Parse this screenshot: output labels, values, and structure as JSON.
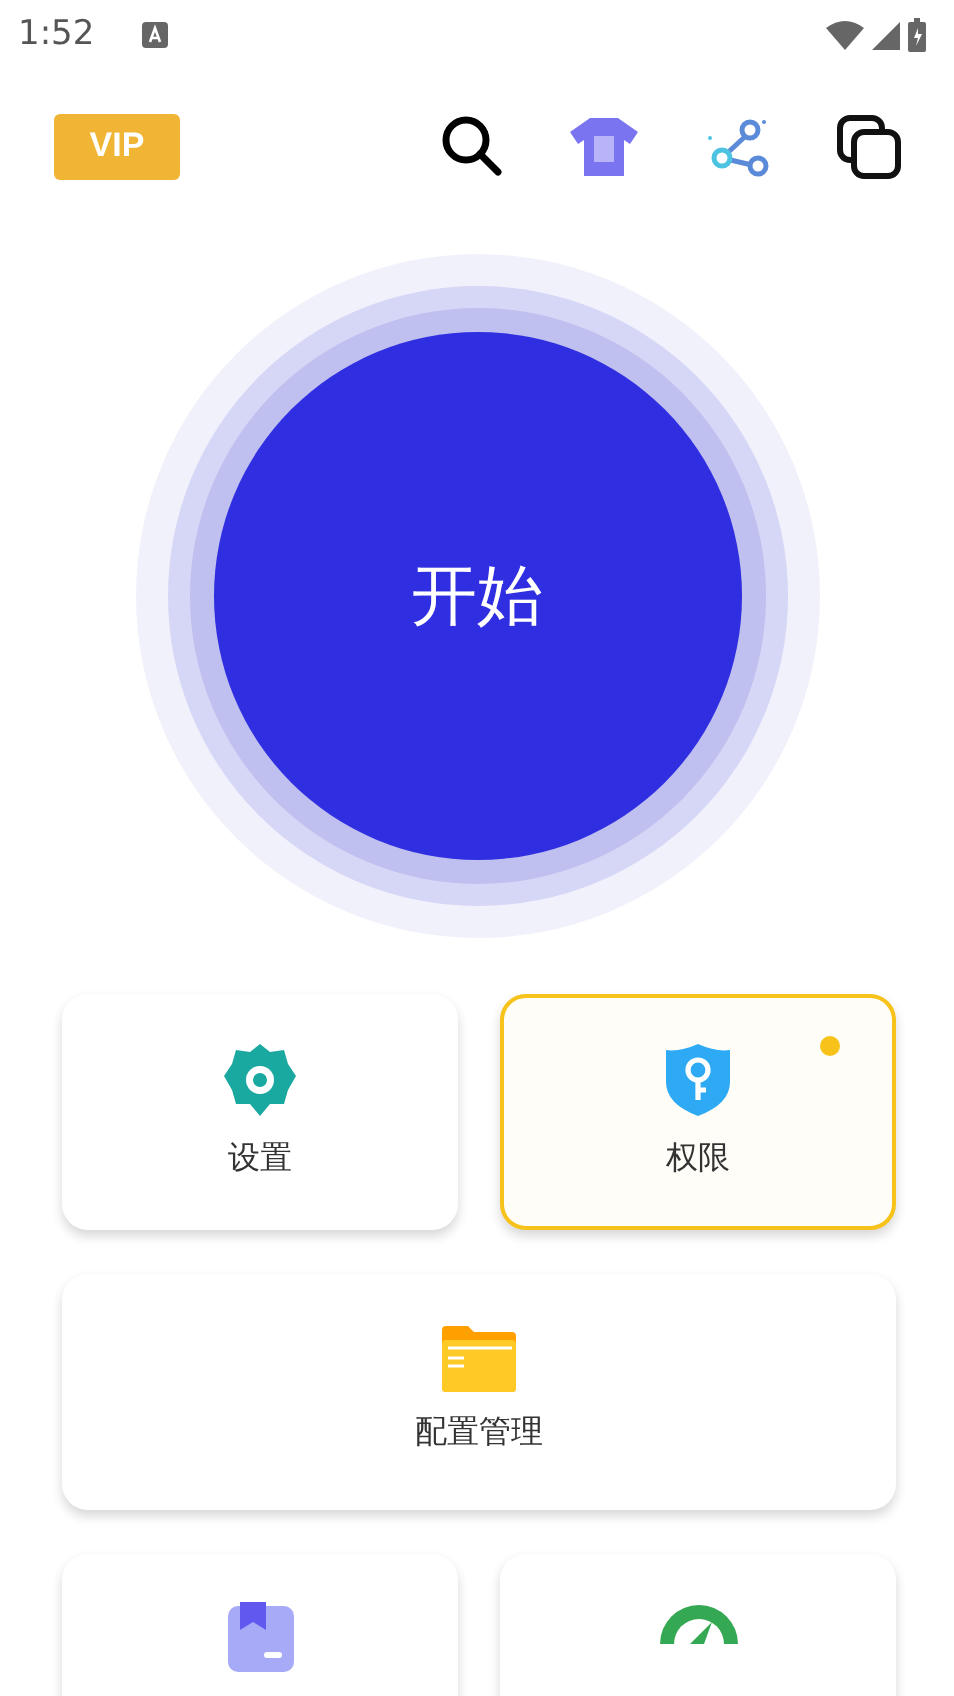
{
  "status_bar": {
    "time": "1:52"
  },
  "header": {
    "vip": "VIP"
  },
  "start_button": {
    "label": "开始"
  },
  "tiles": [
    {
      "label": "设置",
      "highlighted": false,
      "wide": false
    },
    {
      "label": "权限",
      "highlighted": true,
      "wide": false
    },
    {
      "label": "配置管理",
      "highlighted": false,
      "wide": true
    },
    {
      "highlighted": false,
      "wide": false
    },
    {
      "highlighted": false,
      "wide": false
    }
  ]
}
